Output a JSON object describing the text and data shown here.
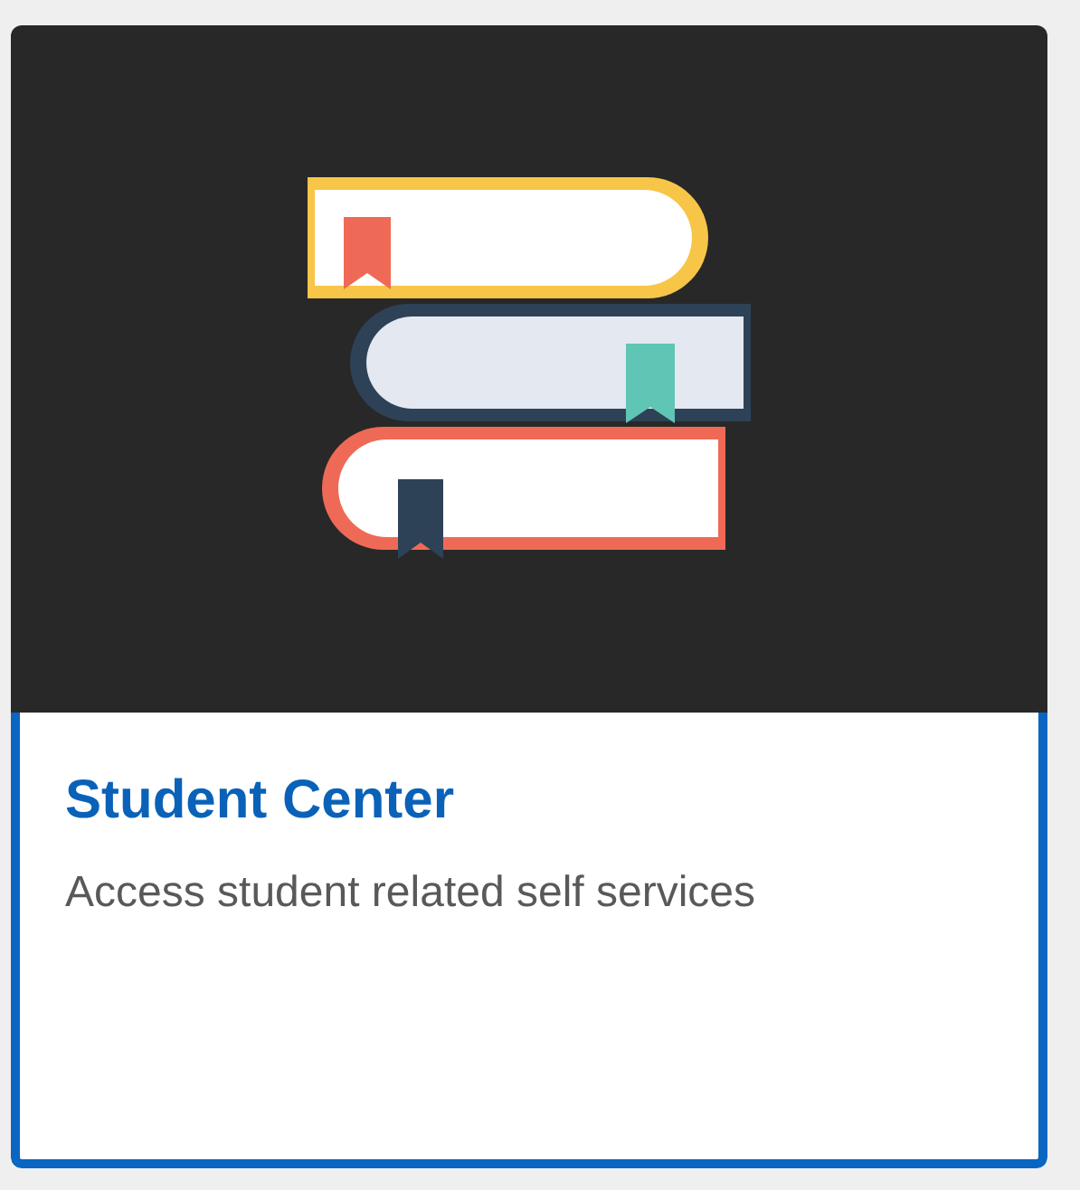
{
  "card": {
    "title": "Student Center",
    "description": "Access student related self services",
    "selected": true
  }
}
